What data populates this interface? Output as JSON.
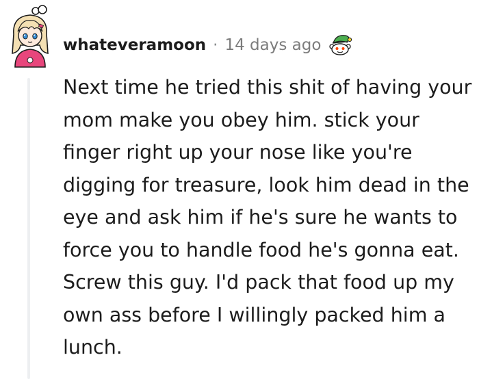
{
  "comment": {
    "username": "whateveramoon",
    "separator": "·",
    "timestamp": "14 days ago",
    "award_icon": "snoo-elf-award-icon",
    "avatar_icon": "anime-girl-avatar-icon",
    "body": "Next time he tried this shit of having your mom make you obey him. stick your finger right up your nose like you're digging for treasure, look him dead in the eye and ask him if he's sure he wants to force you to handle food he's gonna eat. Screw this guy. I'd pack that food up my own ass before I willingly packed him a lunch."
  },
  "colors": {
    "text": "#1c1c1c",
    "meta": "#7c7c7c",
    "thread_line": "#edeff1",
    "avatar_hair": "#f4e0b3",
    "avatar_hoodie": "#e8467c"
  }
}
